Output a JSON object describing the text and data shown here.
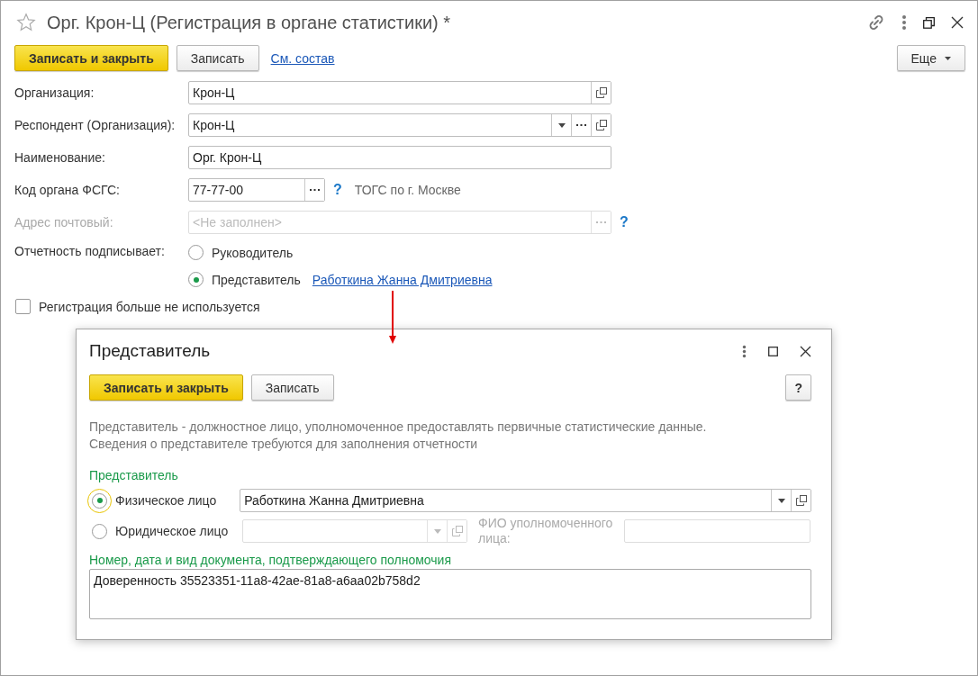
{
  "window": {
    "title": "Орг. Крон-Ц (Регистрация в органе статистики) *",
    "favorite": false
  },
  "toolbar": {
    "buttons": [
      {
        "label": "Записать и закрыть",
        "kind": "primary"
      },
      {
        "label": "Записать",
        "kind": "normal"
      }
    ],
    "link": "См. состав",
    "more": "Еще"
  },
  "fields": [
    {
      "label": "Организация:",
      "value": "Крон-Ц",
      "kind": "wide",
      "disabled": false,
      "buttons": [
        {
          "kind": "open"
        }
      ]
    },
    {
      "label": "Респондент (Организация):",
      "value": "Крон-Ц",
      "kind": "wide",
      "disabled": false,
      "buttons": [
        {
          "kind": "dropdown"
        },
        {
          "kind": "select"
        },
        {
          "kind": "open"
        }
      ]
    },
    {
      "label": "Наименование:",
      "value": "Орг. Крон-Ц",
      "kind": "wide",
      "disabled": false
    },
    {
      "label": "Код органа ФСГС:",
      "value": "77-77-00",
      "kind": "short",
      "disabled": false,
      "buttons": [
        {
          "kind": "select"
        }
      ],
      "help": "?",
      "note": "ТОГС по г. Москве"
    },
    {
      "label": "Адрес почтовый:",
      "placeholder": "<Не заполнен>",
      "kind": "wide",
      "disabled": true,
      "buttons": [
        {
          "kind": "select"
        }
      ],
      "help": "?"
    }
  ],
  "signer": {
    "label": "Отчетность подписывает:",
    "options": [
      {
        "label": "Руководитель",
        "selected": false
      },
      {
        "label": "Представитель",
        "selected": true,
        "link": "Работкина Жанна Дмитриевна"
      }
    ]
  },
  "unused": {
    "label": "Регистрация больше не используется",
    "checked": false
  },
  "dialog": {
    "title": "Представитель",
    "buttons": [
      {
        "label": "Записать и закрыть",
        "kind": "primary"
      },
      {
        "label": "Записать",
        "kind": "normal"
      }
    ],
    "help": "?",
    "description": [
      "Представитель - должностное лицо, уполномоченное предоставлять первичные статистические данные.",
      "Сведения о представителе требуются для заполнения отчетности"
    ],
    "section": "Представитель",
    "options": [
      {
        "label": "Физическое лицо",
        "selected": true,
        "focused": true,
        "kind": "person",
        "value": "Работкина Жанна Дмитриевна"
      },
      {
        "label": "Юридическое лицо",
        "selected": false,
        "focused": false,
        "kind": "company",
        "agent_label": "ФИО уполномоченного лица:"
      }
    ],
    "document_label": "Номер, дата и вид документа, подтверждающего полномочия",
    "document": "Доверенность 35523351-11a8-42ae-81a8-a6aa02b758d2"
  }
}
